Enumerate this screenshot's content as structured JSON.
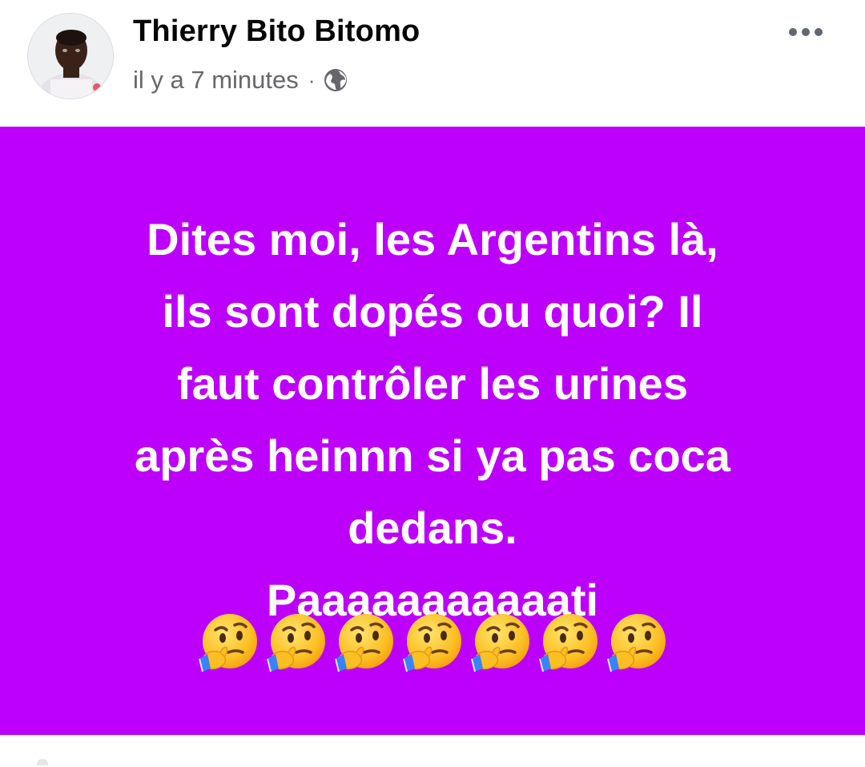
{
  "post": {
    "author": "Thierry Bito Bitomo",
    "timestamp": "il y a 7 minutes",
    "separator": "·",
    "privacy_icon": "globe-icon",
    "more_icon": "more-options-icon",
    "background_color": "#bc00fb",
    "text_color": "#ffffff",
    "text_lines": [
      "Dites moi, les Argentins là,",
      "ils sont dopés ou quoi? Il",
      "faut contrôler les urines",
      "après heinnn si ya pas coca",
      "dedans.",
      "Paaaaaaaaaaati"
    ],
    "emoji_count": 7,
    "emoji_name": "thinking-face-emoji"
  }
}
